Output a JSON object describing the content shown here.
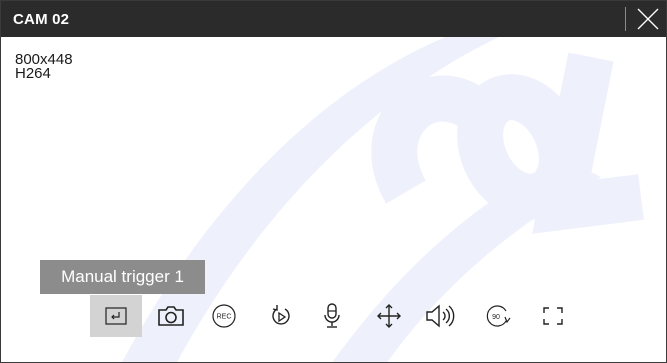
{
  "window": {
    "title": "CAM 02"
  },
  "stream": {
    "resolution": "800x448",
    "codec": "H264"
  },
  "tooltip": {
    "text": "Manual trigger 1"
  },
  "toolbar": {
    "record_icon_text": "REC",
    "rotate_icon_text": "90"
  },
  "colors": {
    "titlebar": "#2b2b2b",
    "tooltip_bg": "#8c8c8c",
    "active_tool_bg": "#d3d3d3",
    "icon": "#222222",
    "watermark": "#eef1fb"
  }
}
